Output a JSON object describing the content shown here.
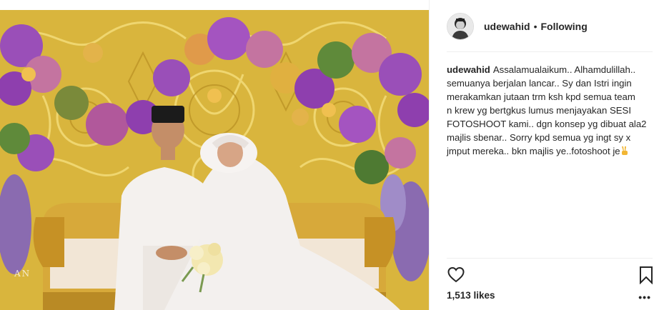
{
  "photo": {
    "alt_subject": "wedding-photo",
    "watermark_text": "AN"
  },
  "header": {
    "username": "udewahid",
    "separator": "•",
    "follow_status": "Following"
  },
  "caption": {
    "username": "udewahid",
    "lines": [
      "Assalamualaikum.. Alhamdulillah..",
      "semuanya berjalan lancar.. Sy dan Istri ingin",
      "merakamkan jutaan trm ksh kpd semua team",
      "n krew yg bertgkus lumus menjayakan SESI",
      "FOTOSHOOT kami.. dgn konsep yg dibuat ala2",
      "majlis sbenar.. Sorry kpd semua yg ingt sy x",
      "jmput mereka.. bkn majlis ye..fotoshoot je"
    ],
    "emoji": "victory-hand-emoji"
  },
  "actions": {
    "like_icon": "heart-icon",
    "save_icon": "bookmark-icon"
  },
  "likes": {
    "text": "1,513 likes"
  },
  "more": {
    "label": "•••"
  },
  "colors": {
    "text": "#262626",
    "divider": "#efefef",
    "backdrop_gold": "#d8b43a",
    "flower_purple": "#8e3fae"
  }
}
